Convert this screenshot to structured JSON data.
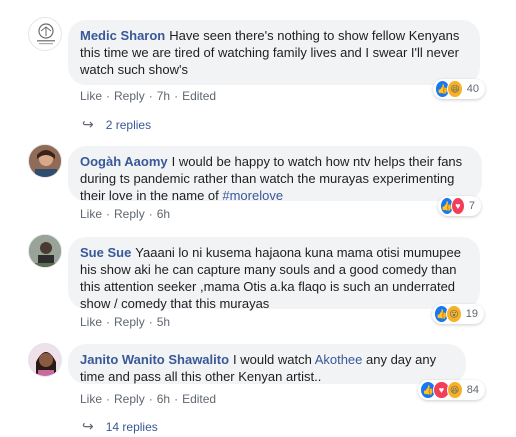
{
  "comments": [
    {
      "author": "Medic Sharon",
      "text": "Have seen there's nothing to show fellow Kenyans this time we are tired of watching family lives and I swear I'll never watch such show's",
      "actions": {
        "like": "Like",
        "reply": "Reply",
        "time": "7h",
        "edited": "Edited"
      },
      "reaction_count": "40",
      "replies": "2 replies"
    },
    {
      "author": "Oogàh Aaomy",
      "text": "I would be happy to watch how ntv helps their fans during ts pandemic rather than watch the murayas experimenting their love in the name of ",
      "hashtag": "#morelove",
      "actions": {
        "like": "Like",
        "reply": "Reply",
        "time": "6h"
      },
      "reaction_count": "7"
    },
    {
      "author": "Sue Sue",
      "text": "Yaaani lo ni kusema hajaona kuna mama otisi mumupee his show aki he can capture many souls and a good comedy than this attention seeker ,mama Otis a.ka flaqo is such an underrated show / comedy that this murayas",
      "actions": {
        "like": "Like",
        "reply": "Reply",
        "time": "5h"
      },
      "reaction_count": "19"
    },
    {
      "author": "Janito Wanito Shawalito",
      "text_before": "I would watch ",
      "mention": "Akothee",
      "text_after": " any day any time and pass all this other Kenyan artist..",
      "actions": {
        "like": "Like",
        "reply": "Reply",
        "time": "6h",
        "edited": "Edited"
      },
      "reaction_count": "84",
      "replies": "14 replies"
    }
  ]
}
